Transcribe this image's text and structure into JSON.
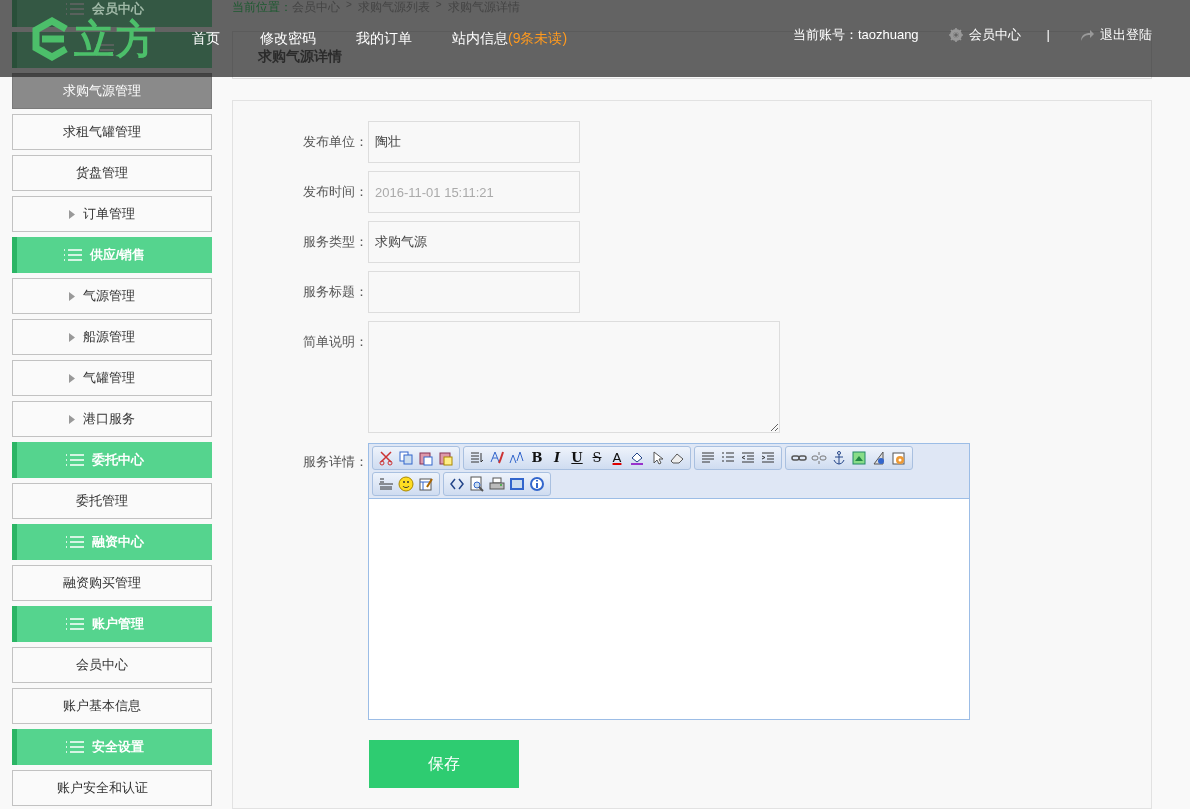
{
  "header": {
    "logo": "立方",
    "nav": [
      {
        "label": "首页"
      },
      {
        "label": "修改密码"
      },
      {
        "label": "我的订单"
      },
      {
        "label": "站内信息",
        "badge": "(9条未读)"
      }
    ],
    "account": "当前账号：taozhuang",
    "member_link": "会员中心",
    "separator": "|",
    "logout": "退出登陆"
  },
  "sidebar": [
    {
      "kind": "header",
      "label": "会员中心"
    },
    {
      "kind": "header"
    },
    {
      "kind": "item",
      "label": "求购气源管理",
      "selected": true,
      "expandable": false
    },
    {
      "kind": "item",
      "label": "求租气罐管理",
      "selected": false,
      "expandable": false
    },
    {
      "kind": "item",
      "label": "货盘管理",
      "selected": false,
      "expandable": false
    },
    {
      "kind": "item",
      "label": "订单管理",
      "selected": false,
      "expandable": true
    },
    {
      "kind": "header",
      "label": "供应/销售"
    },
    {
      "kind": "item",
      "label": "气源管理",
      "selected": false,
      "expandable": true
    },
    {
      "kind": "item",
      "label": "船源管理",
      "selected": false,
      "expandable": true
    },
    {
      "kind": "item",
      "label": "气罐管理",
      "selected": false,
      "expandable": true
    },
    {
      "kind": "item",
      "label": "港口服务",
      "selected": false,
      "expandable": true
    },
    {
      "kind": "header",
      "label": "委托中心"
    },
    {
      "kind": "item",
      "label": "委托管理",
      "selected": false,
      "expandable": false
    },
    {
      "kind": "header",
      "label": "融资中心"
    },
    {
      "kind": "item",
      "label": "融资购买管理",
      "selected": false,
      "expandable": false
    },
    {
      "kind": "header",
      "label": "账户管理"
    },
    {
      "kind": "item",
      "label": "会员中心",
      "selected": false,
      "expandable": false
    },
    {
      "kind": "item",
      "label": "账户基本信息",
      "selected": false,
      "expandable": false
    },
    {
      "kind": "header",
      "label": "安全设置"
    },
    {
      "kind": "item",
      "label": "账户安全和认证",
      "selected": false,
      "expandable": false
    }
  ],
  "breadcrumb": {
    "prefix": "当前位置：",
    "items": [
      "会员中心",
      "求购气源列表",
      "求购气源详情"
    ],
    "separator": ">"
  },
  "page_title": "求购气源详情",
  "form": {
    "fields": [
      {
        "kind": "input",
        "label": "发布单位：",
        "value": "陶壮",
        "disabled": false
      },
      {
        "kind": "input",
        "label": "发布时间：",
        "value": "2016-11-01 15:11:21",
        "disabled": true
      },
      {
        "kind": "input",
        "label": "服务类型：",
        "value": "求购气源",
        "disabled": false
      },
      {
        "kind": "input",
        "label": "服务标题："
      },
      {
        "kind": "textarea",
        "label": "简单说明："
      },
      {
        "kind": "editor",
        "label": "服务详情：",
        "toolbar": [
          [
            [
              {
                "kind": "cut"
              },
              {
                "kind": "copy"
              },
              {
                "kind": "paste"
              },
              {
                "kind": "paste-text"
              }
            ],
            [
              {
                "kind": "format"
              },
              {
                "kind": "font"
              },
              {
                "kind": "font-size"
              },
              {
                "kind": "bold",
                "label": "B"
              },
              {
                "kind": "italic",
                "label": "I"
              },
              {
                "kind": "underline",
                "label": "U"
              },
              {
                "kind": "strike",
                "label": "S"
              },
              {
                "kind": "font-color",
                "label": "A"
              },
              {
                "kind": "highlight"
              },
              {
                "kind": "select"
              },
              {
                "kind": "eraser"
              }
            ],
            [
              {
                "kind": "align"
              },
              {
                "kind": "list"
              },
              {
                "kind": "outdent"
              },
              {
                "kind": "indent"
              }
            ],
            [
              {
                "kind": "link"
              },
              {
                "kind": "unlink"
              },
              {
                "kind": "anchor"
              },
              {
                "kind": "image"
              },
              {
                "kind": "flash"
              },
              {
                "kind": "media"
              }
            ]
          ],
          [
            [
              {
                "kind": "rule"
              },
              {
                "kind": "emoticon"
              },
              {
                "kind": "table"
              }
            ],
            [
              {
                "kind": "source"
              },
              {
                "kind": "preview"
              },
              {
                "kind": "print"
              },
              {
                "kind": "fullscreen"
              },
              {
                "kind": "about"
              }
            ]
          ]
        ]
      }
    ],
    "save": "保存"
  }
}
